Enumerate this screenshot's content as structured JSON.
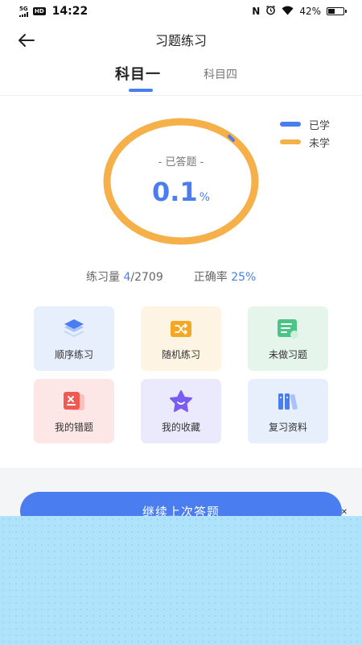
{
  "status_bar": {
    "network": "5G",
    "hd": "HD",
    "time": "14:22",
    "battery": "42%"
  },
  "header": {
    "title": "习题练习"
  },
  "tabs": [
    {
      "label": "科目一",
      "active": true
    },
    {
      "label": "科目四",
      "active": false
    }
  ],
  "legend": [
    {
      "label": "已学",
      "color": "#4a7ef0"
    },
    {
      "label": "未学",
      "color": "#f5b049"
    }
  ],
  "progress": {
    "label": "- 已答题 -",
    "value": "0.1",
    "unit": "%",
    "fraction": 0.001
  },
  "stats": {
    "practice_label": "练习量",
    "practiced": "4",
    "total": "/2709",
    "accuracy_label": "正确率",
    "accuracy": "25%"
  },
  "tiles": [
    {
      "label": "顺序练习",
      "icon": "layers-icon",
      "bg": "#e7eefc"
    },
    {
      "label": "随机练习",
      "icon": "shuffle-icon",
      "bg": "#fef4e4"
    },
    {
      "label": "未做习题",
      "icon": "note-icon",
      "bg": "#e6f5ec"
    },
    {
      "label": "我的错题",
      "icon": "wrong-question-icon",
      "bg": "#fde7e6"
    },
    {
      "label": "我的收藏",
      "icon": "star-icon",
      "bg": "#ebeafc"
    },
    {
      "label": "复习资料",
      "icon": "books-icon",
      "bg": "#e7eefc"
    }
  ],
  "primary_button": {
    "label": "继续上次答题"
  },
  "overlay": {
    "close_label": "✕"
  }
}
